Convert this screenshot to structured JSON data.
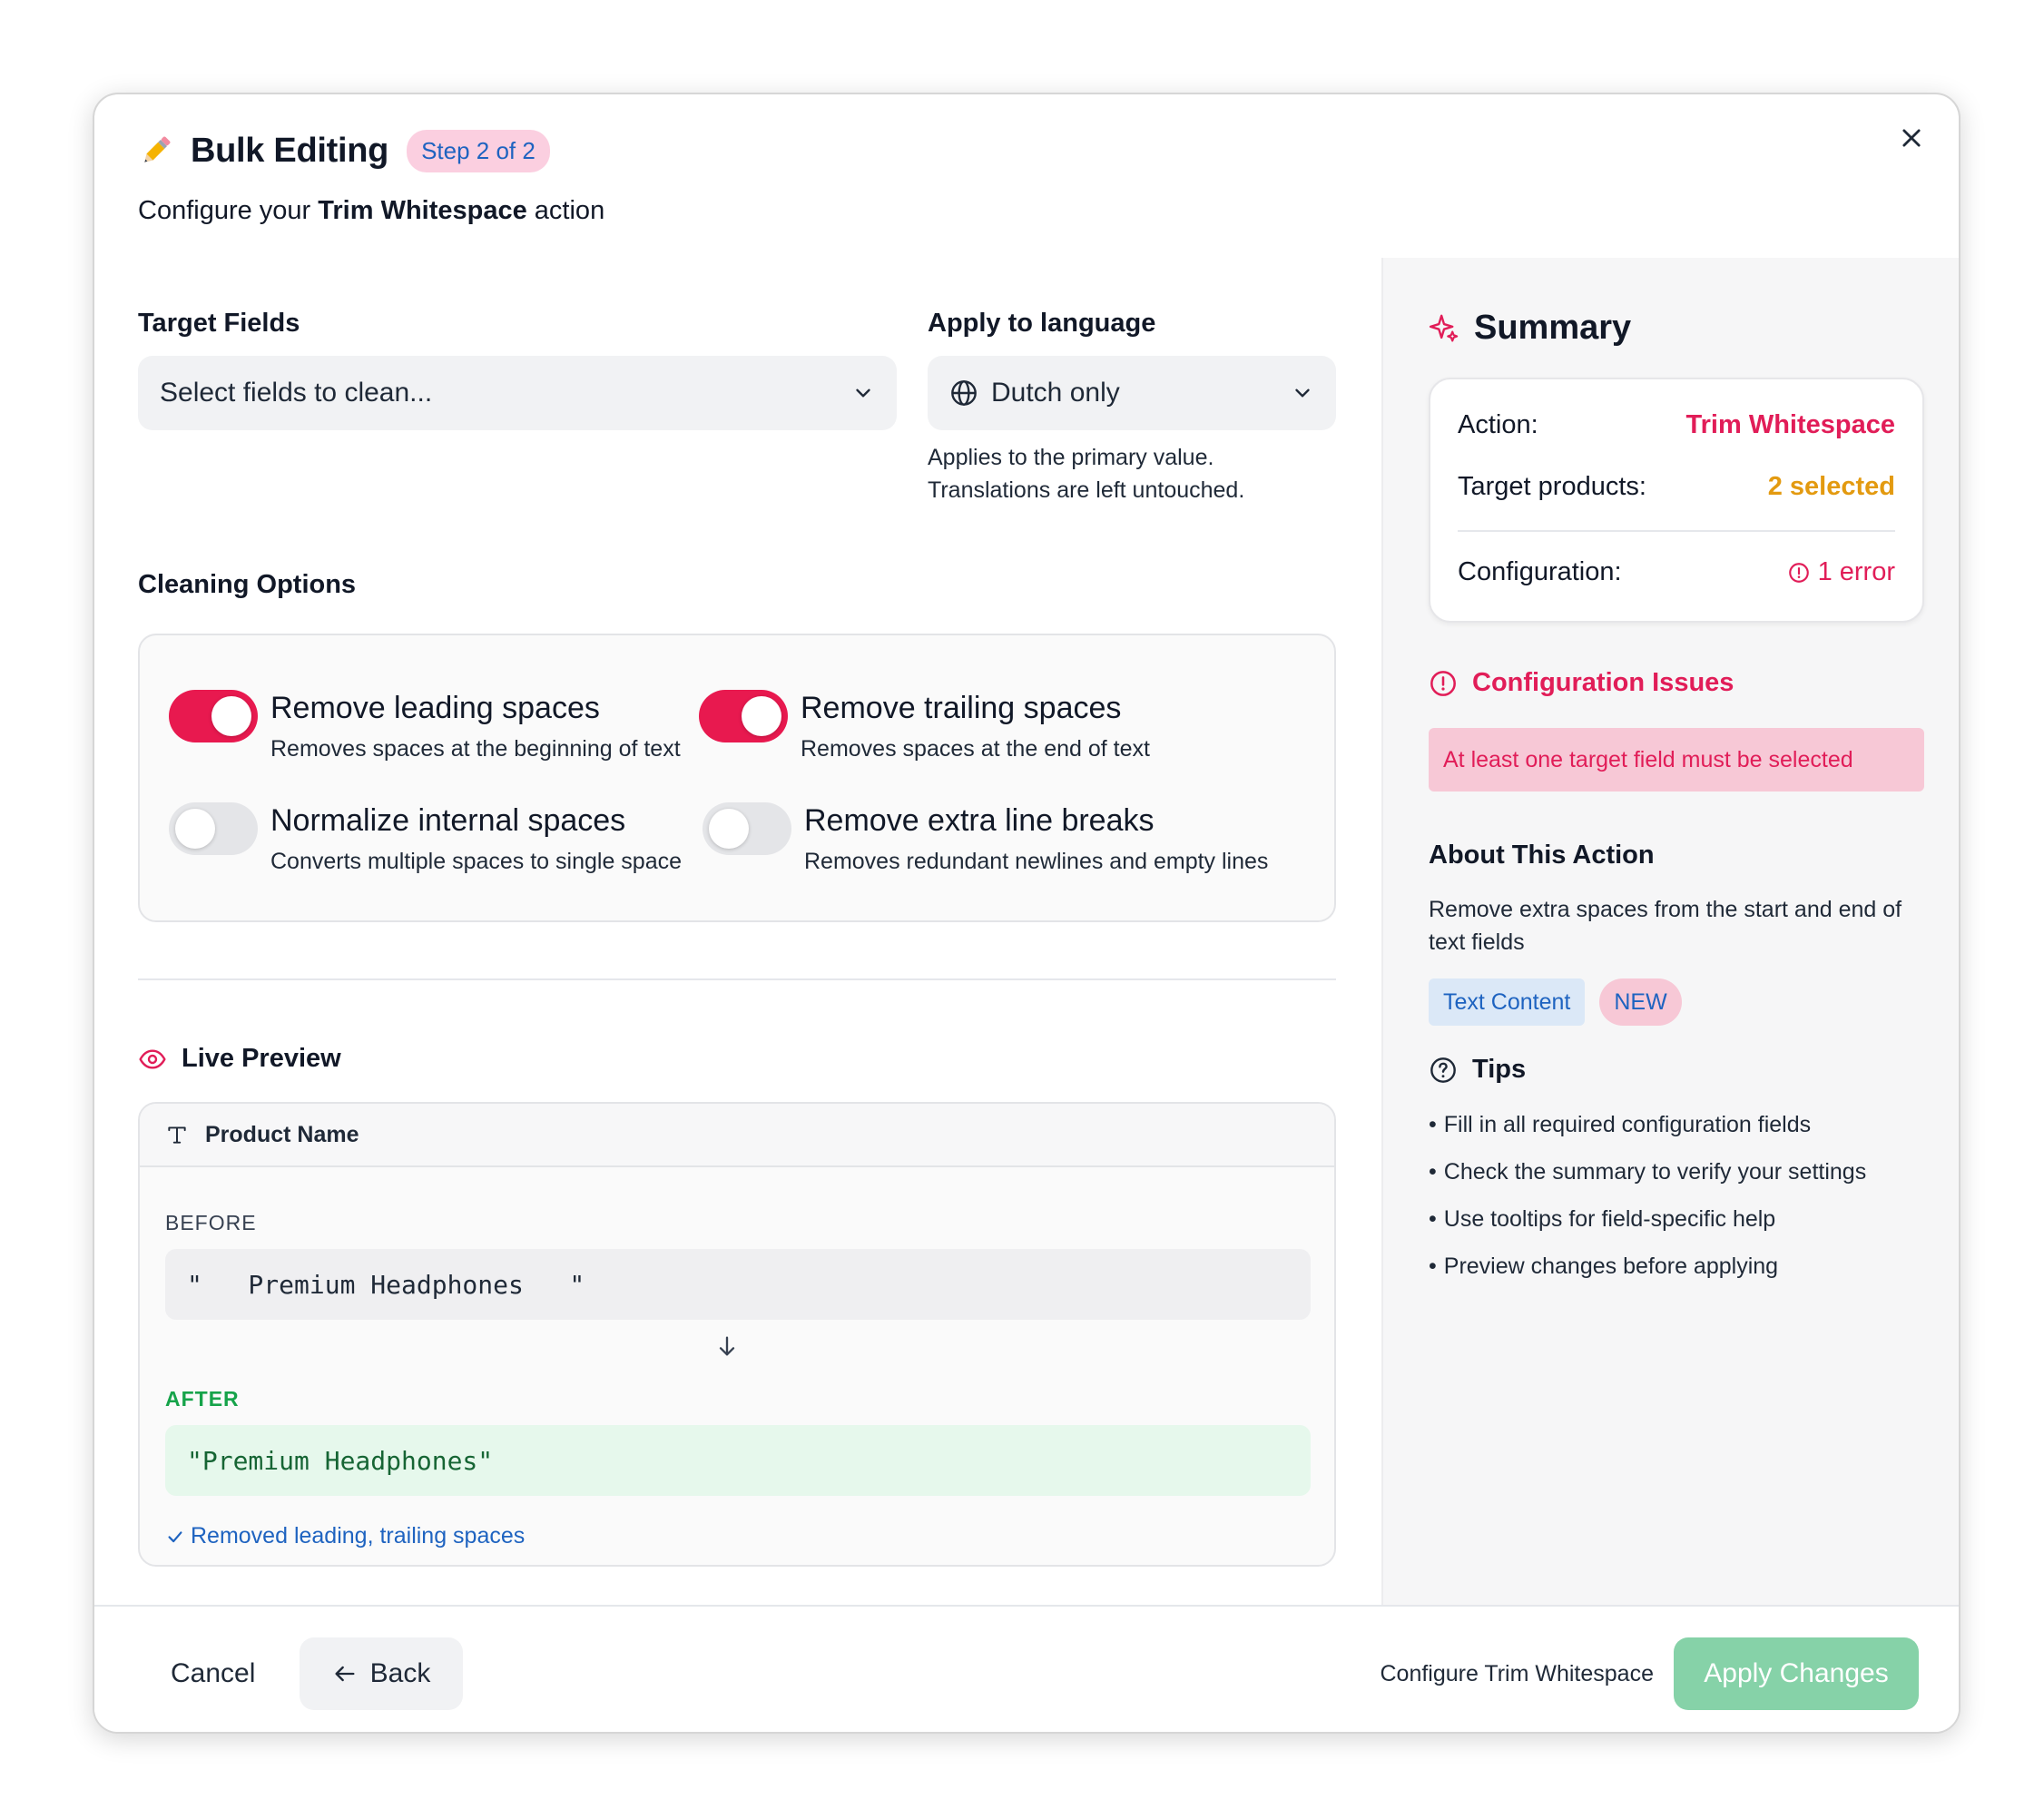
{
  "header": {
    "title": "Bulk Editing",
    "step_badge": "Step 2 of 2",
    "subtitle_prefix": "Configure your ",
    "subtitle_action": "Trim Whitespace",
    "subtitle_suffix": " action"
  },
  "target_fields": {
    "label": "Target Fields",
    "placeholder": "Select fields to clean..."
  },
  "language": {
    "label": "Apply to language",
    "value": "Dutch only",
    "note_line1": "Applies to the primary value.",
    "note_line2": "Translations are left untouched."
  },
  "cleaning": {
    "label": "Cleaning Options",
    "options": [
      {
        "title": "Remove leading spaces",
        "desc": "Removes spaces at the beginning of text",
        "enabled": true
      },
      {
        "title": "Remove trailing spaces",
        "desc": "Removes spaces at the end of text",
        "enabled": true
      },
      {
        "title": "Normalize internal spaces",
        "desc": "Converts multiple spaces to single space",
        "enabled": false
      },
      {
        "title": "Remove extra line breaks",
        "desc": "Removes redundant newlines and empty lines",
        "enabled": false
      }
    ]
  },
  "preview": {
    "label": "Live Preview",
    "field": "Product Name",
    "before_label": "BEFORE",
    "before_value": "\"   Premium Headphones   \"",
    "after_label": "AFTER",
    "after_value": "\"Premium Headphones\"",
    "result": "Removed leading, trailing spaces"
  },
  "summary": {
    "title": "Summary",
    "action_key": "Action:",
    "action_value": "Trim Whitespace",
    "target_key": "Target products:",
    "target_value": "2 selected",
    "config_key": "Configuration:",
    "config_value": "1 error"
  },
  "issues": {
    "title": "Configuration Issues",
    "message": "At least one target field must be selected"
  },
  "about": {
    "title": "About This Action",
    "description": "Remove extra spaces from the start and end of text fields",
    "tag_category": "Text Content",
    "tag_new": "NEW"
  },
  "tips": {
    "title": "Tips",
    "items": [
      "Fill in all required configuration fields",
      "Check the summary to verify your settings",
      "Use tooltips for field-specific help",
      "Preview changes before applying"
    ]
  },
  "footer": {
    "cancel": "Cancel",
    "back": "Back",
    "note": "Configure Trim Whitespace",
    "apply": "Apply Changes"
  },
  "colors": {
    "accent": "#e8194f",
    "link_blue": "#1e63c0",
    "warning": "#e39a10",
    "success": "#16a34a",
    "apply_disabled": "#86d2a8"
  },
  "icons": {
    "header": "pencil-icon",
    "close": "close-icon",
    "language": "globe-icon",
    "preview": "eye-icon",
    "field": "text-type-icon",
    "summary": "sparkle-icon",
    "issues": "alert-circle-icon",
    "tips": "help-circle-icon",
    "back": "arrow-left-icon"
  }
}
